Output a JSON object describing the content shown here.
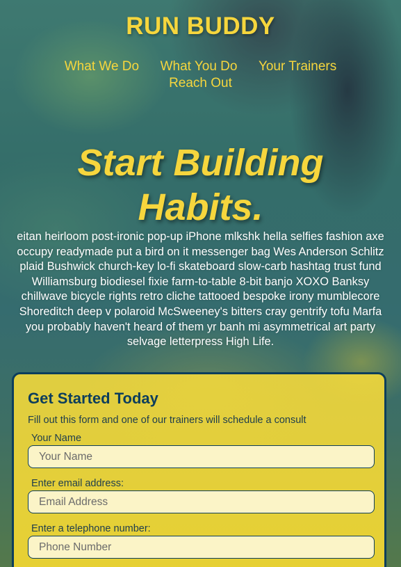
{
  "header": {
    "brand": "RUN BUDDY"
  },
  "nav": {
    "items": [
      {
        "label": "What We Do"
      },
      {
        "label": "What You Do"
      },
      {
        "label": "Your Trainers"
      },
      {
        "label": "Reach Out"
      }
    ]
  },
  "hero": {
    "heading_line1": "Start Building",
    "heading_line2": "Habits.",
    "body": "eitan heirloom post-ironic pop-up iPhone mlkshk hella selfies fashion axe occupy readymade put a bird on it messenger bag Wes Anderson Schlitz plaid Bushwick church-key lo-fi skateboard slow-carb hashtag trust fund Williamsburg biodiesel fixie farm-to-table 8-bit banjo XOXO Banksy chillwave bicycle rights retro cliche tattooed bespoke irony mumblecore Shoreditch deep v polaroid McSweeney's bitters cray gentrify tofu Marfa you probably haven't heard of them yr banh mi asymmetrical art party selvage letterpress High Life."
  },
  "form": {
    "title": "Get Started Today",
    "subtitle": "Fill out this form and one of our trainers will schedule a consult",
    "fields": [
      {
        "label": "Your Name",
        "placeholder": "Your Name",
        "value": ""
      },
      {
        "label": "Enter email address:",
        "placeholder": "Email Address",
        "value": ""
      },
      {
        "label": "Enter a telephone number:",
        "placeholder": "Phone Number",
        "value": ""
      }
    ]
  },
  "colors": {
    "accent_yellow": "#f6d63d",
    "navy": "#0d3e5c",
    "input_bg": "#fbf4c7"
  }
}
